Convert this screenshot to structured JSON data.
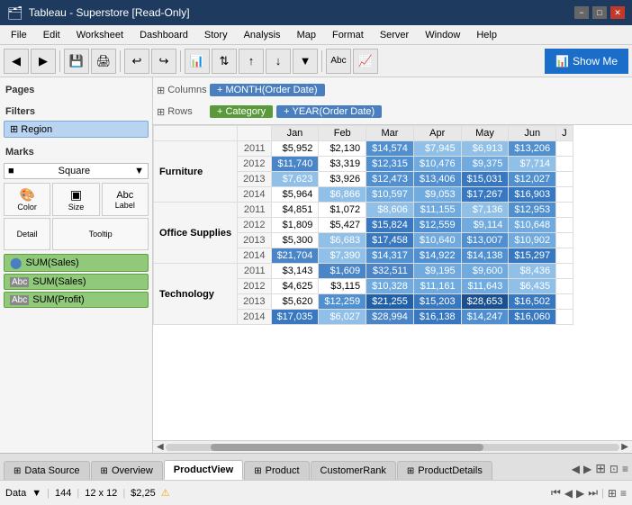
{
  "titleBar": {
    "icon": "🗂",
    "title": "Tableau - Superstore [Read-Only]",
    "minimizeLabel": "−",
    "maximizeLabel": "□",
    "closeLabel": "✕"
  },
  "menuBar": {
    "items": [
      "File",
      "Edit",
      "Worksheet",
      "Dashboard",
      "Story",
      "Analysis",
      "Map",
      "Format",
      "Server",
      "Window",
      "Help"
    ]
  },
  "toolbar": {
    "showMeLabel": "Show Me",
    "buttons": [
      "⬅",
      "➡",
      "💾",
      "🖨",
      "⚙",
      "📊",
      "Abc"
    ]
  },
  "pages": {
    "title": "Pages"
  },
  "filters": {
    "title": "Filters",
    "items": [
      "Region"
    ]
  },
  "marks": {
    "title": "Marks",
    "dropdownValue": "Square",
    "buttons": [
      {
        "label": "Color",
        "icon": "🎨"
      },
      {
        "label": "Size",
        "icon": "▣"
      },
      {
        "label": "Label",
        "icon": "Abc"
      }
    ],
    "buttons2": [
      {
        "label": "Detail",
        "icon": ""
      },
      {
        "label": "Tooltip",
        "icon": ""
      }
    ],
    "pills": [
      {
        "icon": "⬤",
        "label": "SUM(Sales)"
      },
      {
        "icon": "Abc",
        "label": "SUM(Sales)"
      },
      {
        "icon": "Abc",
        "label": "SUM(Profit)"
      }
    ]
  },
  "shelf": {
    "columnsLabel": "Columns",
    "rowsLabel": "Rows",
    "columnPill": "MONTH(Order Date)",
    "rowPills": [
      "Category",
      "YEAR(Order Date)"
    ]
  },
  "table": {
    "months": [
      "Jan",
      "Feb",
      "Mar",
      "Apr",
      "May",
      "Jun",
      "J"
    ],
    "categories": [
      {
        "name": "Furniture",
        "years": [
          {
            "year": "2011",
            "values": [
              "$5,952",
              "$2,130",
              "$14,574",
              "$7,945",
              "$6,913",
              "$13,206",
              ""
            ],
            "highlight": [
              false,
              false,
              false,
              false,
              false,
              false,
              false
            ]
          },
          {
            "year": "2012",
            "values": [
              "$11,740",
              "$3,319",
              "$12,315",
              "$10,476",
              "$9,375",
              "$7,714",
              ""
            ],
            "highlight": [
              true,
              false,
              false,
              false,
              false,
              false,
              false
            ]
          },
          {
            "year": "2013",
            "values": [
              "$7,623",
              "$3,926",
              "$12,473",
              "$13,406",
              "$15,031",
              "$12,027",
              ""
            ],
            "highlight": [
              false,
              false,
              false,
              false,
              false,
              false,
              false
            ]
          },
          {
            "year": "2014",
            "values": [
              "$5,964",
              "$6,866",
              "$10,597",
              "$9,053",
              "$17,267",
              "$16,903",
              ""
            ],
            "highlight": [
              false,
              false,
              false,
              false,
              false,
              false,
              false
            ]
          }
        ]
      },
      {
        "name": "Office Supplies",
        "years": [
          {
            "year": "2011",
            "values": [
              "$4,851",
              "$1,072",
              "$8,606",
              "$11,155",
              "$7,136",
              "$12,953",
              ""
            ],
            "highlight": [
              false,
              false,
              false,
              false,
              false,
              false,
              false
            ]
          },
          {
            "year": "2012",
            "values": [
              "$1,809",
              "$5,427",
              "$15,824",
              "$12,559",
              "$9,114",
              "$10,648",
              ""
            ],
            "highlight": [
              false,
              false,
              false,
              false,
              false,
              false,
              false
            ]
          },
          {
            "year": "2013",
            "values": [
              "$5,300",
              "$6,683",
              "$17,458",
              "$10,640",
              "$13,007",
              "$10,902",
              ""
            ],
            "highlight": [
              false,
              false,
              false,
              false,
              false,
              false,
              false
            ]
          },
          {
            "year": "2014",
            "values": [
              "$21,704",
              "$7,390",
              "$14,317",
              "$14,922",
              "$14,138",
              "$15,297",
              ""
            ],
            "highlight": [
              true,
              false,
              false,
              false,
              false,
              false,
              false
            ]
          }
        ]
      },
      {
        "name": "Technology",
        "years": [
          {
            "year": "2011",
            "values": [
              "$3,143",
              "$1,609",
              "$32,511",
              "$9,195",
              "$9,600",
              "$8,436",
              ""
            ],
            "highlight": [
              false,
              true,
              true,
              false,
              false,
              false,
              false
            ]
          },
          {
            "year": "2012",
            "values": [
              "$4,625",
              "$3,115",
              "$10,328",
              "$11,161",
              "$11,643",
              "$6,435",
              ""
            ],
            "highlight": [
              false,
              false,
              false,
              false,
              false,
              false,
              false
            ]
          },
          {
            "year": "2013",
            "values": [
              "$5,620",
              "$12,259",
              "$21,255",
              "$15,203",
              "$28,653",
              "$16,502",
              ""
            ],
            "highlight": [
              false,
              false,
              false,
              false,
              false,
              false,
              false
            ]
          },
          {
            "year": "2014",
            "values": [
              "$17,035",
              "$6,027",
              "$28,994",
              "$16,138",
              "$14,247",
              "$16,060",
              ""
            ],
            "highlight": [
              false,
              false,
              true,
              false,
              false,
              false,
              false
            ]
          }
        ]
      }
    ]
  },
  "tabs": {
    "items": [
      {
        "label": "Data Source",
        "icon": "⊞",
        "active": false
      },
      {
        "label": "Overview",
        "icon": "⊞",
        "active": false
      },
      {
        "label": "ProductView",
        "icon": "",
        "active": true
      },
      {
        "label": "Product",
        "icon": "⊞",
        "active": false
      },
      {
        "label": "CustomerRank",
        "icon": "",
        "active": false
      },
      {
        "label": "ProductDetails",
        "icon": "⊞",
        "active": false
      }
    ]
  },
  "statusBar": {
    "label": "Data",
    "value1": "144",
    "value2": "12 x 12",
    "value3": "$2,25",
    "warningIcon": "⚠"
  },
  "colors": {
    "highlight_blue": "#4a7fbf",
    "highlight_selected": "#d0e8ff",
    "cell_blue": "#5090d0",
    "cell_darkblue": "#2060a0",
    "tab_active_bg": "#ffffff",
    "titlebar_bg": "#1e3a5f"
  }
}
